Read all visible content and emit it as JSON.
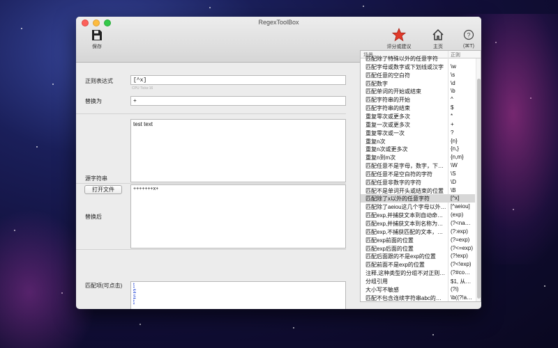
{
  "window": {
    "title": "RegexToolBox"
  },
  "toolbar": {
    "save_label": "保存",
    "rate_label": "评分或建议",
    "home_label": "主页",
    "help_label": "(⌘T)"
  },
  "form": {
    "regex_label": "正则表达式",
    "regex_value": "[^x]",
    "cpu_hint": "CPU Ticks:16",
    "replace_label": "替换为",
    "replace_value": "+",
    "source_label": "源字符串",
    "open_file_label": "打开文件",
    "source_text": "test text",
    "result_label": "替换后",
    "result_text": "+++++++x+",
    "matches_label": "匹配项(可点击)",
    "match_items": [
      "t",
      "e",
      "s",
      "t",
      "t",
      "e",
      "t"
    ]
  },
  "patterns": {
    "header_scene": "场景",
    "header_regex": "正则",
    "rows": [
      {
        "scene": "匹配除了特殊以外的任意字符",
        "regex": ""
      },
      {
        "scene": "匹配字母或数字或下划线或汉字",
        "regex": "\\w"
      },
      {
        "scene": "匹配任意的空白符",
        "regex": "\\s"
      },
      {
        "scene": "匹配数字",
        "regex": "\\d"
      },
      {
        "scene": "匹配单词的开始或结束",
        "regex": "\\b"
      },
      {
        "scene": "匹配字符串的开始",
        "regex": "^"
      },
      {
        "scene": "匹配字符串的结束",
        "regex": "$"
      },
      {
        "scene": "重复零次或更多次",
        "regex": "*"
      },
      {
        "scene": "重复一次或更多次",
        "regex": "+"
      },
      {
        "scene": "重复零次或一次",
        "regex": "?"
      },
      {
        "scene": "重复n次",
        "regex": "{n}"
      },
      {
        "scene": "重复n次或更多次",
        "regex": "{n,}"
      },
      {
        "scene": "重复n到m次",
        "regex": "{n,m}"
      },
      {
        "scene": "匹配任意不是字母，数字，下…",
        "regex": "\\W"
      },
      {
        "scene": "匹配任意不是空白符的字符",
        "regex": "\\S"
      },
      {
        "scene": "匹配任意非数字的字符",
        "regex": "\\D"
      },
      {
        "scene": "匹配不是单词开头或结束的位置",
        "regex": "\\B"
      },
      {
        "scene": "匹配除了x以外的任意字符",
        "regex": "[^x]"
      },
      {
        "scene": "匹配除了aeiou这几个字母以外…",
        "regex": "[^aeiou]"
      },
      {
        "scene": "匹配exp,并捕获文本到自动命…",
        "regex": "(exp)"
      },
      {
        "scene": "匹配exp,并捕获文本到名称为…",
        "regex": "(?<na…"
      },
      {
        "scene": "匹配exp,不捕获匹配的文本，…",
        "regex": "(?:exp)"
      },
      {
        "scene": "匹配exp前面的位置",
        "regex": "(?=exp)"
      },
      {
        "scene": "匹配exp后面的位置",
        "regex": "(?<=exp)"
      },
      {
        "scene": "匹配后面跟的不是exp的位置",
        "regex": "(?!exp)"
      },
      {
        "scene": "匹配前面不是exp的位置",
        "regex": "(?<!exp)"
      },
      {
        "scene": "注释,这种类型的分组不对正则…",
        "regex": "(?#co…"
      },
      {
        "scene": "分组引用",
        "regex": "$1, 从…"
      },
      {
        "scene": "大小写不敏感",
        "regex": "(?i)"
      },
      {
        "scene": "匹配不包含连续字符串abc的…",
        "regex": "\\b((?!a…"
      }
    ]
  },
  "colors": {
    "selected_row": "#d7d7d7",
    "link": "#2a4bd7",
    "star": "#e23a2a"
  }
}
